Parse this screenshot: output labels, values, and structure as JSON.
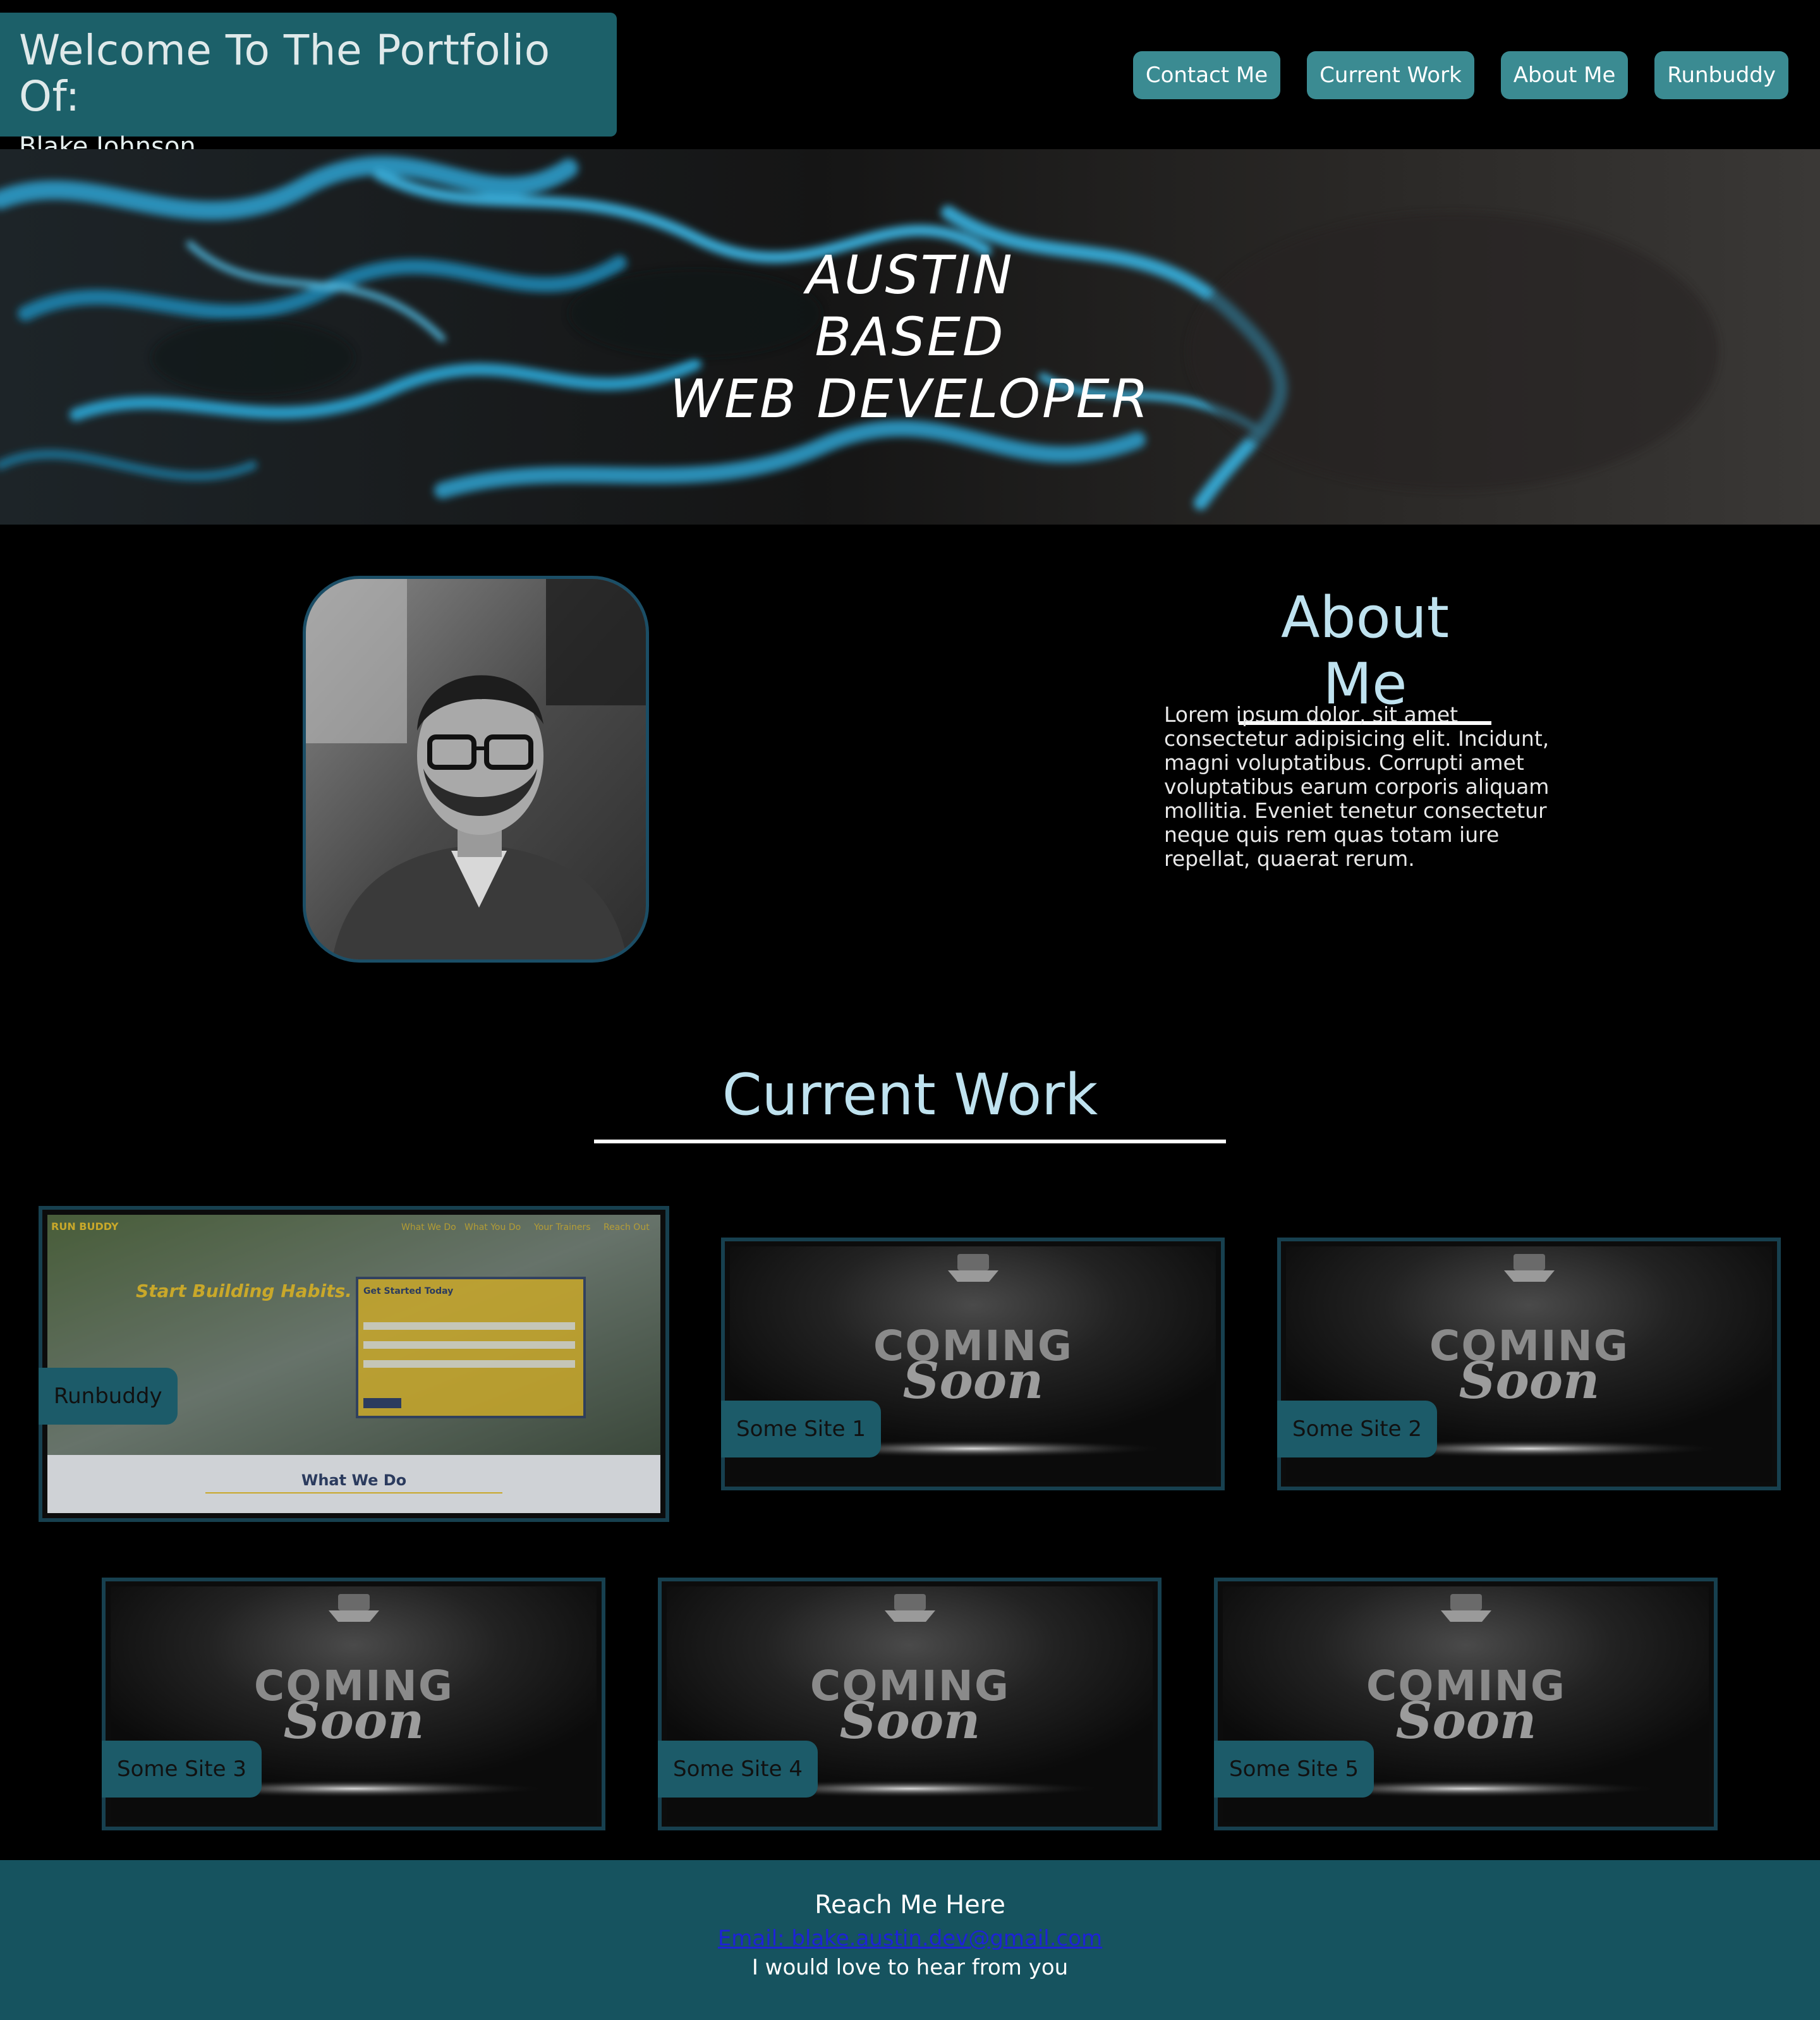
{
  "header": {
    "title": "Welcome To The Portfolio Of:",
    "name": "Blake Johnson"
  },
  "nav": {
    "items": [
      "Contact Me",
      "Current Work",
      "About Me",
      "Runbuddy"
    ]
  },
  "hero": {
    "line1": "AUSTIN",
    "line2": "BASED",
    "line3": "WEB DEVELOPER"
  },
  "about": {
    "title": "About Me",
    "text": "Lorem ipsum dolor, sit amet consectetur adipisicing elit. Incidunt, magni voluptatibus. Corrupti amet voluptatibus earum corporis aliquam mollitia. Eveniet tenetur consectetur neque quis rem quas totam iure repellat, quaerat rerum."
  },
  "work": {
    "title": "Current Work",
    "cards": [
      {
        "label": "Runbuddy"
      },
      {
        "label": "Some Site 1"
      },
      {
        "label": "Some Site 2"
      },
      {
        "label": "Some Site 3"
      },
      {
        "label": "Some Site 4"
      },
      {
        "label": "Some Site 5"
      }
    ],
    "runbuddy_preview": {
      "brand": "RUN BUDDY",
      "nav": [
        "What We Do",
        "What You Do",
        "Your Trainers",
        "Reach Out"
      ],
      "headline": "Start Building Habits.",
      "form_title": "Get Started Today",
      "section": "What We Do"
    },
    "coming_soon": {
      "line1": "COMING",
      "line2": "Soon"
    }
  },
  "footer": {
    "heading": "Reach Me Here",
    "email": "Email: blake.austin.dev@gmail.com",
    "note": "I would love to hear from you"
  },
  "colors": {
    "accent": "#1c6069",
    "nav_button": "#3b8b92",
    "heading_text": "#bfe2ef",
    "footer_bg": "#16535f"
  }
}
